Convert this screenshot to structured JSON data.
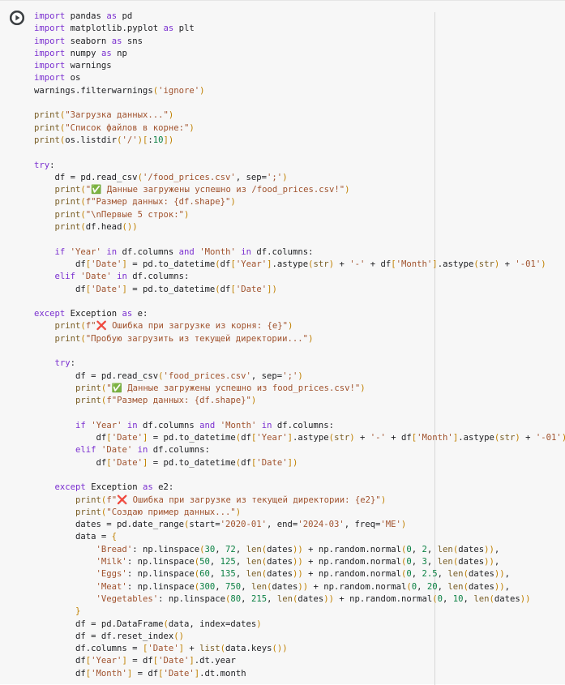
{
  "cell": {
    "run_button_icon": "play-icon",
    "lines": [
      "import pandas as pd",
      "import matplotlib.pyplot as plt",
      "import seaborn as sns",
      "import numpy as np",
      "import warnings",
      "import os",
      "warnings.filterwarnings('ignore')",
      "",
      "print(\"Загрузка данных...\")",
      "print(\"Список файлов в корне:\")",
      "print(os.listdir('/')[:10])",
      "",
      "try:",
      "    df = pd.read_csv('/food_prices.csv', sep=';')",
      "    print(\"✅ Данные загружены успешно из /food_prices.csv!\")",
      "    print(f\"Размер данных: {df.shape}\")",
      "    print(\"\\nПервые 5 строк:\")",
      "    print(df.head())",
      "",
      "    if 'Year' in df.columns and 'Month' in df.columns:",
      "        df['Date'] = pd.to_datetime(df['Year'].astype(str) + '-' + df['Month'].astype(str) + '-01')",
      "    elif 'Date' in df.columns:",
      "        df['Date'] = pd.to_datetime(df['Date'])",
      "",
      "except Exception as e:",
      "    print(f\"❌ Ошибка при загрузке из корня: {e}\")",
      "    print(\"Пробую загрузить из текущей директории...\")",
      "",
      "    try:",
      "        df = pd.read_csv('food_prices.csv', sep=';')",
      "        print(\"✅ Данные загружены успешно из food_prices.csv!\")",
      "        print(f\"Размер данных: {df.shape}\")",
      "",
      "        if 'Year' in df.columns and 'Month' in df.columns:",
      "            df['Date'] = pd.to_datetime(df['Year'].astype(str) + '-' + df['Month'].astype(str) + '-01')",
      "        elif 'Date' in df.columns:",
      "            df['Date'] = pd.to_datetime(df['Date'])",
      "",
      "    except Exception as e2:",
      "        print(f\"❌ Ошибка при загрузке из текущей директории: {e2}\")",
      "        print(\"Создаю пример данных...\")",
      "        dates = pd.date_range(start='2020-01', end='2024-03', freq='ME')",
      "        data = {",
      "            'Bread': np.linspace(30, 72, len(dates)) + np.random.normal(0, 2, len(dates)),",
      "            'Milk': np.linspace(50, 125, len(dates)) + np.random.normal(0, 3, len(dates)),",
      "            'Eggs': np.linspace(60, 135, len(dates)) + np.random.normal(0, 2.5, len(dates)),",
      "            'Meat': np.linspace(300, 750, len(dates)) + np.random.normal(0, 20, len(dates)),",
      "            'Vegetables': np.linspace(80, 215, len(dates)) + np.random.normal(0, 10, len(dates))",
      "        }",
      "        df = pd.DataFrame(data, index=dates)",
      "        df = df.reset_index()",
      "        df.columns = ['Date'] + list(data.keys())",
      "        df['Year'] = df['Date'].dt.year",
      "        df['Month'] = df['Date'].dt.month"
    ]
  }
}
